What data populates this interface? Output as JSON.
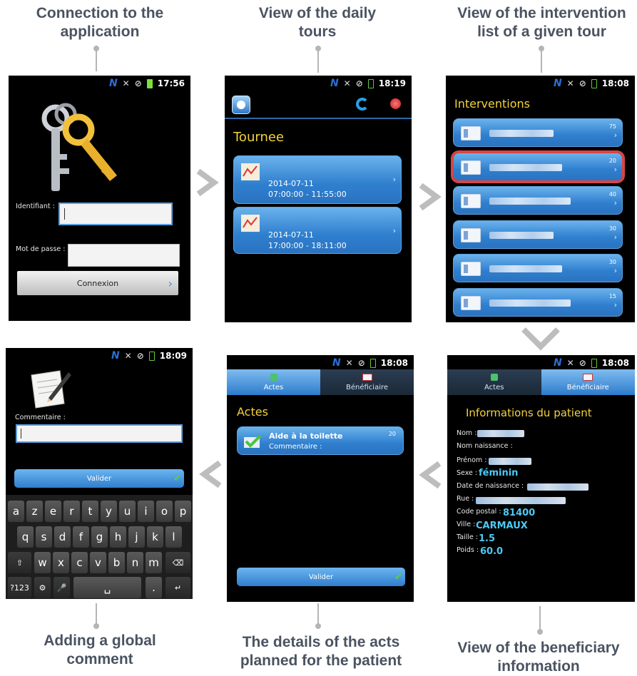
{
  "captions": {
    "login": "Connection to the application",
    "tours": "View of the daily tours",
    "interventions": "View of the intervention list of a given tour",
    "beneficiary": "View of the beneficiary information",
    "acts": "The details of the acts planned for the patient",
    "comment": "Adding a global comment"
  },
  "login_screen": {
    "time": "17:56",
    "identifiant_label": "Identifiant :",
    "identifiant_value": "",
    "password_label": "Mot de passe :",
    "password_value": "",
    "connect_button": "Connexion"
  },
  "tours_screen": {
    "time": "18:19",
    "title": "Tournee",
    "tours": [
      {
        "date": "2014-07-11",
        "time": "07:00:00 - 11:55:00"
      },
      {
        "date": "2014-07-11",
        "time": "17:00:00 - 18:11:00"
      }
    ]
  },
  "interventions_screen": {
    "time": "18:08",
    "title": "Interventions",
    "items": [
      {
        "count": "75",
        "selected": false
      },
      {
        "count": "20",
        "selected": true
      },
      {
        "count": "40",
        "selected": false
      },
      {
        "count": "30",
        "selected": false
      },
      {
        "count": "30",
        "selected": false
      },
      {
        "count": "15",
        "selected": false
      }
    ]
  },
  "beneficiary_screen": {
    "time": "18:08",
    "tab_acts": "Actes",
    "tab_beneficiary": "Bénéficiaire",
    "title": "Informations du patient",
    "fields": {
      "nom_label": "Nom :",
      "nom_naissance_label": "Nom naissance :",
      "prenom_label": "Prénom :",
      "sexe_label": "Sexe :",
      "sexe_value": "féminin",
      "date_naissance_label": "Date de naissance :",
      "rue_label": "Rue :",
      "code_postal_label": "Code postal :",
      "code_postal_value": "81400",
      "ville_label": "Ville :",
      "ville_value": "CARMAUX",
      "taille_label": "Taille :",
      "taille_value": "1.5",
      "poids_label": "Poids :",
      "poids_value": "60.0"
    }
  },
  "acts_screen": {
    "time": "18:08",
    "tab_acts": "Actes",
    "tab_beneficiary": "Bénéficiaire",
    "title": "Actes",
    "act_name": "Aide à la toilette",
    "act_count": "20",
    "act_comment": "Commentaire :",
    "validate_button": "Valider"
  },
  "comment_screen": {
    "time": "18:09",
    "comment_label": "Commentaire :",
    "comment_value": "",
    "validate_button": "Valider",
    "keyboard": {
      "row1": [
        "a",
        "z",
        "e",
        "r",
        "t",
        "y",
        "u",
        "i",
        "o",
        "p"
      ],
      "row2": [
        "q",
        "s",
        "d",
        "f",
        "g",
        "h",
        "j",
        "k",
        "l"
      ],
      "row3": [
        "w",
        "x",
        "c",
        "v",
        "b",
        "n",
        "m"
      ],
      "symbols_key": "?123",
      "period_key": "."
    }
  },
  "colors": {
    "caption": "#4a5361",
    "accent_yellow": "#f5d33a",
    "card_blue": "#2f7fcf",
    "value_cyan": "#4ec9f5",
    "selected_outline": "#d84545"
  }
}
